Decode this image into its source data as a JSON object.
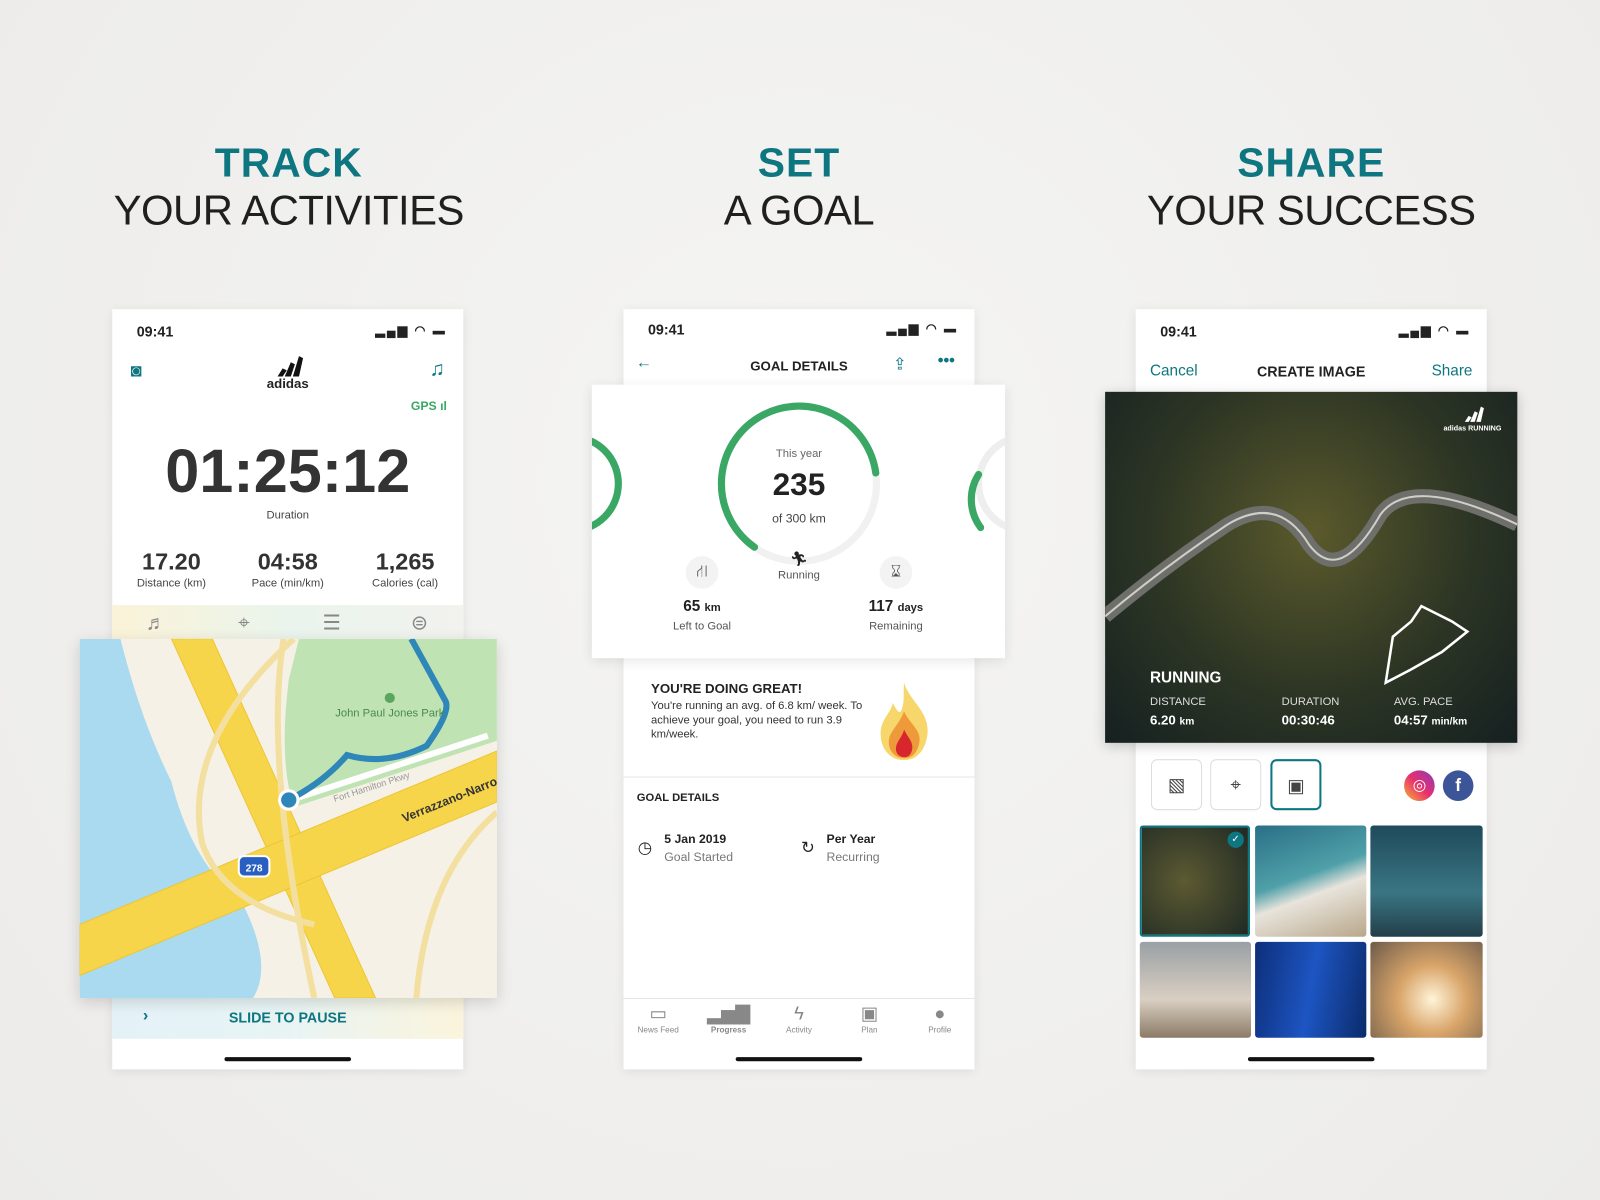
{
  "headings": [
    {
      "bold": "TRACK",
      "sub": "YOUR ACTIVITIES"
    },
    {
      "bold": "SET",
      "sub": "A GOAL"
    },
    {
      "bold": "SHARE",
      "sub": "YOUR SUCCESS"
    }
  ],
  "colors": {
    "accent": "#0e7680",
    "progress": "#3aa864",
    "background": "#efefed"
  },
  "status_bar": {
    "time": "09:41"
  },
  "track": {
    "logo": "adidas",
    "gps_label": "GPS",
    "duration": "01:25:12",
    "duration_label": "Duration",
    "stats": [
      {
        "value": "17.20",
        "label": "Distance (km)"
      },
      {
        "value": "04:58",
        "label": "Pace (min/km)"
      },
      {
        "value": "1,265",
        "label": "Calories (cal)"
      }
    ],
    "tabs": [
      "music-icon",
      "map-icon",
      "stats-icon",
      "settings-toggle-icon"
    ],
    "map": {
      "park": "John Paul Jones Park",
      "street": "Fort Hamilton Pkwy",
      "highway": "Verrazzano-Narro",
      "shield": "278"
    },
    "slide_label": "SLIDE TO PAUSE"
  },
  "goal": {
    "title": "GOAL DETAILS",
    "ring_label": "This year",
    "value": "235",
    "of_label": "of 300 km",
    "progress_fraction": 0.783,
    "activity": "Running",
    "left_value": "65",
    "left_unit": "km",
    "left_label": "Left to Goal",
    "days_value": "117",
    "days_unit": "days",
    "days_label": "Remaining",
    "message_title": "YOU'RE DOING GREAT!",
    "message_body": "You're running an avg. of 6.8 km/ week. To achieve your goal, you need to run 3.9 km/week.",
    "details_heading": "GOAL DETAILS",
    "started_value": "5 Jan 2019",
    "started_label": "Goal Started",
    "recurring_value": "Per Year",
    "recurring_label": "Recurring",
    "nav": [
      {
        "label": "News Feed",
        "icon": "news-feed-icon"
      },
      {
        "label": "Progress",
        "icon": "progress-icon",
        "active": true
      },
      {
        "label": "Activity",
        "icon": "activity-icon"
      },
      {
        "label": "Plan",
        "icon": "plan-icon"
      },
      {
        "label": "Profile",
        "icon": "profile-icon"
      }
    ]
  },
  "share": {
    "cancel": "Cancel",
    "title": "CREATE IMAGE",
    "share": "Share",
    "logo": "adidas RUNNING",
    "activity": "RUNNING",
    "stats": [
      {
        "label": "DISTANCE",
        "value": "6.20",
        "unit": "km"
      },
      {
        "label": "DURATION",
        "value": "00:30:46",
        "unit": ""
      },
      {
        "label": "AVG. PACE",
        "value": "04:57",
        "unit": "min/km"
      }
    ]
  }
}
